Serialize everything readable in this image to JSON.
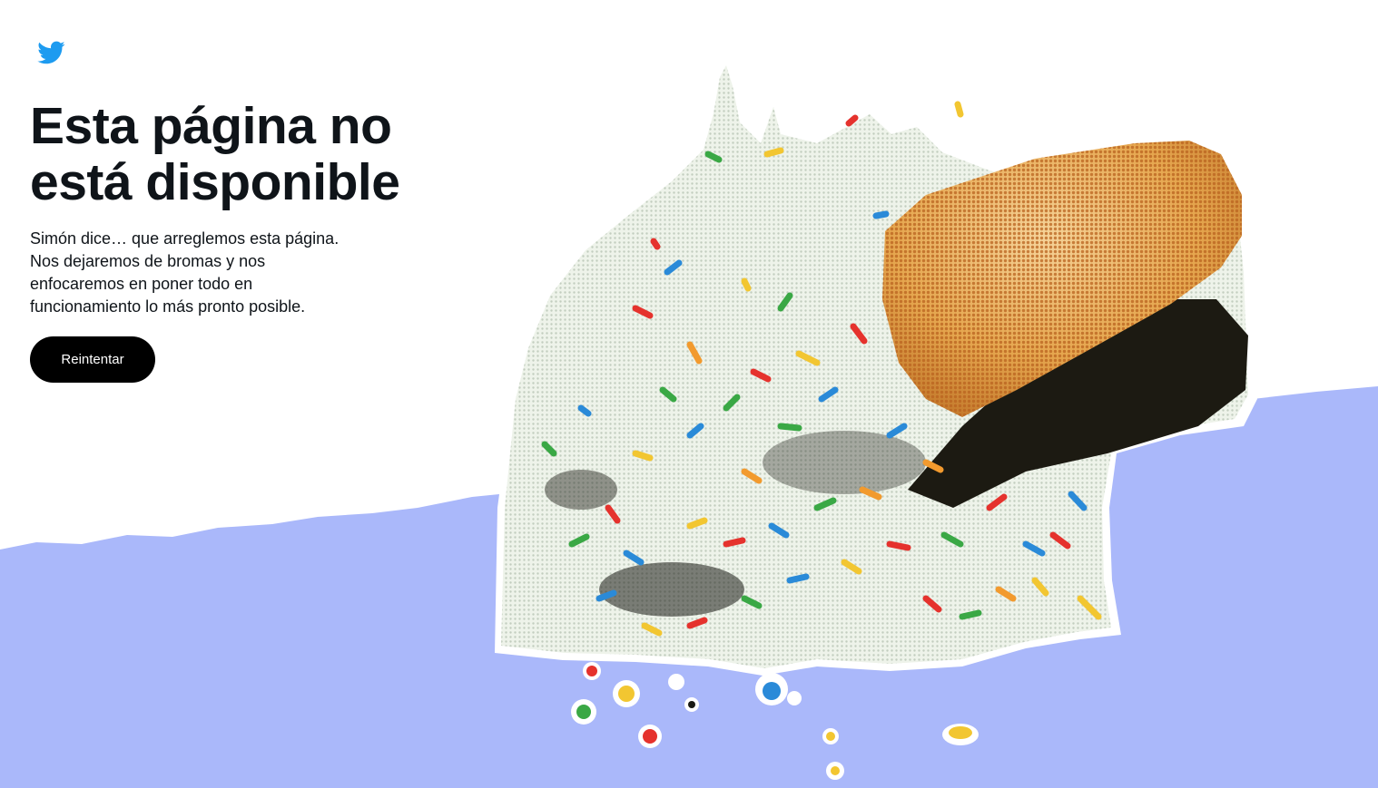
{
  "header": {
    "logo_icon": "twitter-bird-icon",
    "brand_color": "#1d9bf0"
  },
  "error": {
    "title_lines": [
      "Esta página no",
      "está disponible"
    ],
    "message_lines": [
      "Simón dice… que arreglemos esta página.",
      "Nos dejaremos de bromas y nos",
      "enfocaremos en poner todo en",
      "funcionamiento lo más pronto posible."
    ],
    "retry_label": "Reintentar"
  },
  "illustration": {
    "subject": "dropped-ice-cream-cone-icon",
    "floor_color": "#aab8fa",
    "cone_color": "#e0a24a",
    "cream_color": "#f1f4ee"
  }
}
